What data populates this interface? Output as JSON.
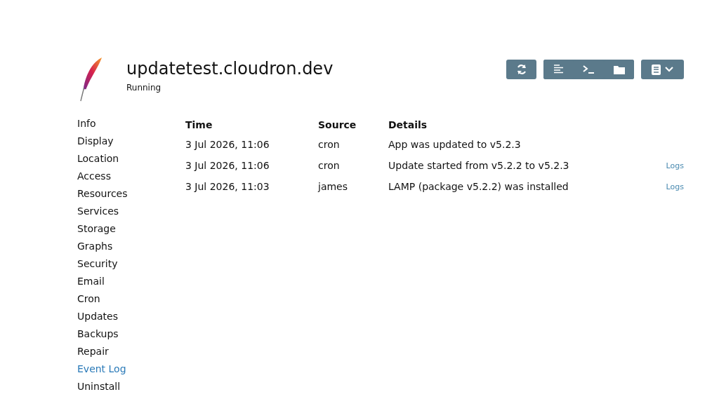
{
  "app": {
    "title": "updatetest.cloudron.dev",
    "status": "Running"
  },
  "sidebar": {
    "items": [
      {
        "label": "Info",
        "selected": false
      },
      {
        "label": "Display",
        "selected": false
      },
      {
        "label": "Location",
        "selected": false
      },
      {
        "label": "Access",
        "selected": false
      },
      {
        "label": "Resources",
        "selected": false
      },
      {
        "label": "Services",
        "selected": false
      },
      {
        "label": "Storage",
        "selected": false
      },
      {
        "label": "Graphs",
        "selected": false
      },
      {
        "label": "Security",
        "selected": false
      },
      {
        "label": "Email",
        "selected": false
      },
      {
        "label": "Cron",
        "selected": false
      },
      {
        "label": "Updates",
        "selected": false
      },
      {
        "label": "Backups",
        "selected": false
      },
      {
        "label": "Repair",
        "selected": false
      },
      {
        "label": "Event Log",
        "selected": true
      },
      {
        "label": "Uninstall",
        "selected": false
      }
    ]
  },
  "table": {
    "columns": [
      "Time",
      "Source",
      "Details"
    ],
    "rows": [
      {
        "time": "3 Jul 2026, 11:06",
        "source": "cron",
        "details": "App was updated to v5.2.3"
      },
      {
        "time": "3 Jul 2026, 11:06",
        "source": "cron",
        "details": "Update started from v5.2.2 to v5.2.3",
        "link": "Logs"
      },
      {
        "time": "3 Jul 2026, 11:03",
        "source": "james",
        "details": "LAMP (package v5.2.2) was installed",
        "link": "Logs"
      }
    ]
  }
}
